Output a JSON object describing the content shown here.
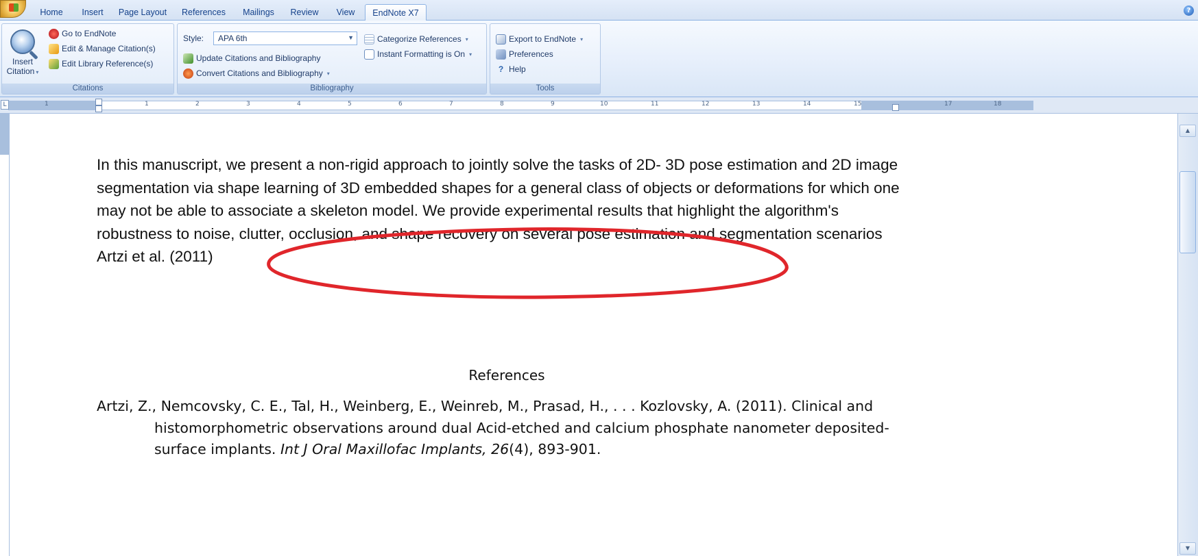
{
  "tabs": [
    {
      "label": "Home",
      "active": false
    },
    {
      "label": "Insert",
      "active": false
    },
    {
      "label": "Page Layout",
      "active": false
    },
    {
      "label": "References",
      "active": false
    },
    {
      "label": "Mailings",
      "active": false
    },
    {
      "label": "Review",
      "active": false
    },
    {
      "label": "View",
      "active": false
    },
    {
      "label": "EndNote X7",
      "active": true
    }
  ],
  "ribbon": {
    "citations": {
      "insert_citation_line1": "Insert",
      "insert_citation_line2": "Citation",
      "go_to_endnote": "Go to EndNote",
      "edit_manage": "Edit & Manage Citation(s)",
      "edit_library": "Edit Library Reference(s)",
      "group_label": "Citations"
    },
    "bibliography": {
      "style_label": "Style:",
      "style_value": "APA 6th",
      "update": "Update Citations and Bibliography",
      "convert": "Convert Citations and Bibliography",
      "categorize": "Categorize References",
      "instant_formatting": "Instant Formatting is On",
      "group_label": "Bibliography"
    },
    "tools": {
      "export": "Export to EndNote",
      "preferences": "Preferences",
      "help": "Help",
      "group_label": "Tools"
    }
  },
  "ruler": {
    "numbers": [
      "1",
      "1",
      "2",
      "3",
      "4",
      "5",
      "6",
      "7",
      "8",
      "9",
      "10",
      "11",
      "12",
      "13",
      "14",
      "15",
      "17",
      "18"
    ]
  },
  "document": {
    "paragraph": "In this manuscript, we present a non-rigid approach to jointly solve the tasks of 2D- 3D pose estimation and 2D image segmentation via shape learning of 3D embedded shapes for a general class of objects or deformations for which one may not be able to associate a skeleton model. We provide experimental results that highlight the algorithm's robustness to noise, clutter, occlusion, and shape recovery on several pose estimation and segmentation scenarios Artzi et al. (2011)",
    "references_heading": "References",
    "reference": {
      "authors": "Artzi, Z., Nemcovsky, C. E., Tal, H., Weinberg, E., Weinreb, M., Prasad, H., . . . Kozlovsky, A. (2011). Clinical and histomorphometric observations around dual Acid-etched and calcium phosphate nanometer deposited-surface implants. ",
      "journal": "Int J Oral Maxillofac Implants, 26",
      "issue_pages": "(4), 893-901."
    }
  },
  "annotation": {
    "color": "#e0262b"
  },
  "colors": {
    "ribbon_bg": "#dfe8f5",
    "tab_text": "#15428b",
    "page_bg": "#ffffff",
    "text": "#111111"
  }
}
